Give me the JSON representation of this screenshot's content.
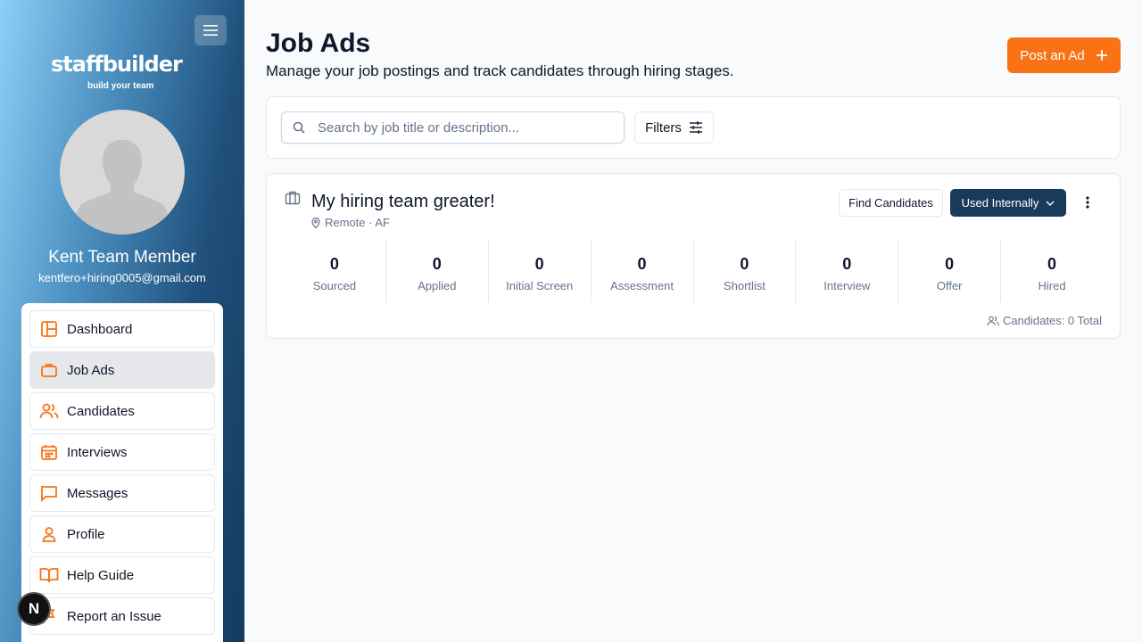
{
  "sidebar": {
    "logo_text": "staffbuilder",
    "logo_tagline": "build your team",
    "user_name": "Kent Team Member",
    "user_email": "kentfero+hiring0005@gmail.com",
    "accent_color": "#f97316",
    "items": [
      {
        "label": "Dashboard",
        "icon": "dashboard-icon"
      },
      {
        "label": "Job Ads",
        "icon": "briefcase-icon",
        "active": true
      },
      {
        "label": "Candidates",
        "icon": "users-icon"
      },
      {
        "label": "Interviews",
        "icon": "calendar-icon"
      },
      {
        "label": "Messages",
        "icon": "message-icon"
      },
      {
        "label": "Profile",
        "icon": "user-icon"
      },
      {
        "label": "Help Guide",
        "icon": "book-icon"
      },
      {
        "label": "Report an Issue",
        "icon": "flag-icon"
      }
    ],
    "badge_letter": "N"
  },
  "header": {
    "title": "Job Ads",
    "subtitle": "Manage your job postings and track candidates through hiring stages.",
    "post_button": "Post an Ad"
  },
  "search": {
    "placeholder": "Search by job title or description...",
    "value": "",
    "filters_label": "Filters"
  },
  "job": {
    "title": "My hiring team greater!",
    "location": "Remote · AF",
    "find_button": "Find Candidates",
    "visibility_button": "Used Internally",
    "stages": [
      {
        "label": "Sourced",
        "count": "0"
      },
      {
        "label": "Applied",
        "count": "0"
      },
      {
        "label": "Initial Screen",
        "count": "0"
      },
      {
        "label": "Assessment",
        "count": "0"
      },
      {
        "label": "Shortlist",
        "count": "0"
      },
      {
        "label": "Interview",
        "count": "0"
      },
      {
        "label": "Offer",
        "count": "0"
      },
      {
        "label": "Hired",
        "count": "0"
      }
    ],
    "candidates_total": "Candidates: 0 Total"
  }
}
